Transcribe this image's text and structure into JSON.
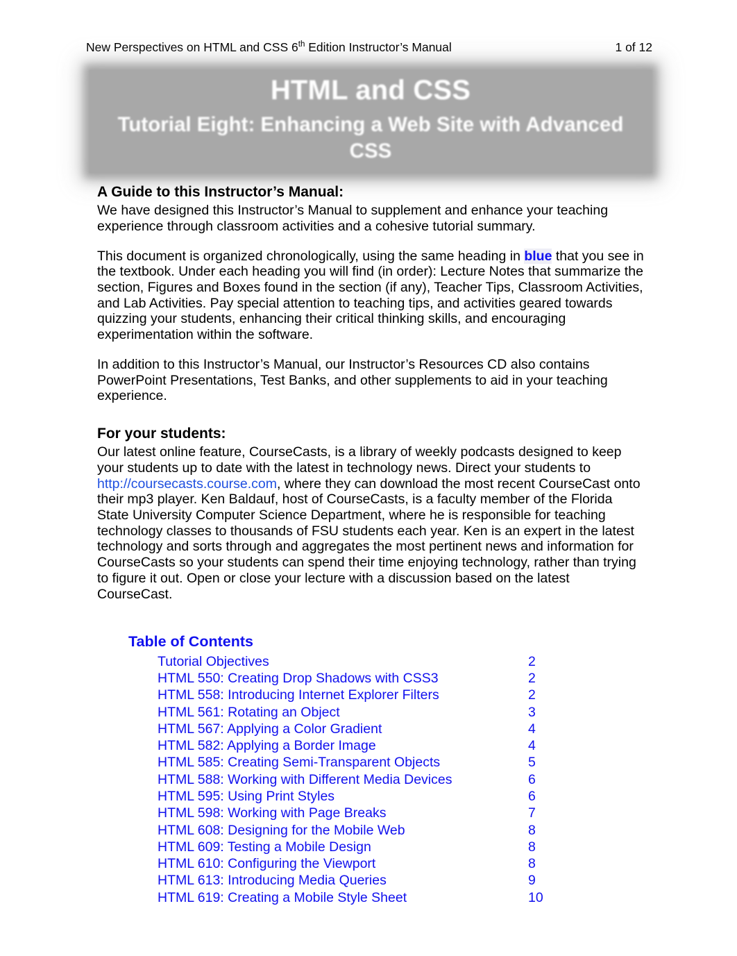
{
  "header": {
    "doc_title_before": "New Perspectives on HTML and CSS 6",
    "doc_title_sup": "th",
    "doc_title_after": " Edition Instructor’s Manual",
    "page_count": "1 of 12"
  },
  "banner": {
    "line1": "HTML and CSS",
    "line2": "Tutorial Eight: Enhancing a Web Site with Advanced CSS",
    "background_color": "#a8a8a8",
    "text_color": "#ffffff"
  },
  "guide": {
    "heading": "A Guide to this Instructor’s Manual:",
    "para1": "We have designed this Instructor’s Manual to supplement and enhance your teaching experience through classroom activities and a cohesive tutorial summary.",
    "para2_part1": "This document is organized chronologically, using the same heading in ",
    "para2_keyword": "blue",
    "para2_part2": " that you see in the textbook. Under each heading you will find (in order): Lecture Notes that summarize the section, Figures and Boxes found in the section (if any), Teacher Tips, Classroom Activities, and Lab Activities. Pay special attention to teaching tips, and activities geared towards quizzing your students, enhancing their critical thinking skills, and encouraging experimentation within the software.",
    "para3": "In addition to this Instructor’s Manual, our Instructor’s Resources CD also contains PowerPoint Presentations, Test Banks, and other supplements to aid in your teaching experience."
  },
  "students": {
    "heading": "For your students:",
    "para_part1": "Our latest online feature, CourseCasts, is a library of weekly podcasts designed to keep your students up to date with the latest in technology news. Direct your students to ",
    "link_text": "http://coursecasts.course.com",
    "para_part2": ", where they can download the most recent CourseCast onto their mp3 player. Ken Baldauf, host of CourseCasts, is a faculty member of the Florida State University Computer Science Department, where he is responsible for teaching technology classes to thousands of FSU students each year. Ken is an expert in the latest technology and sorts through and aggregates the most pertinent news and information for CourseCasts so your students can spend their time enjoying technology, rather than trying to figure it out. Open or close your lecture with a discussion based on the latest CourseCast."
  },
  "toc": {
    "title": "Table of Contents",
    "link_color": "#1111ee",
    "entries": [
      {
        "label": "Tutorial Objectives",
        "page": "2"
      },
      {
        "label": "HTML 550: Creating Drop Shadows with CSS3",
        "page": "2"
      },
      {
        "label": "HTML 558: Introducing Internet Explorer Filters",
        "page": "2"
      },
      {
        "label": "HTML 561: Rotating an Object",
        "page": "3"
      },
      {
        "label": "HTML 567: Applying a Color Gradient",
        "page": "4"
      },
      {
        "label": "HTML 582: Applying a Border Image",
        "page": "4"
      },
      {
        "label": "HTML 585: Creating Semi-Transparent Objects",
        "page": "5"
      },
      {
        "label": "HTML 588: Working with Different Media Devices",
        "page": "6"
      },
      {
        "label": "HTML 595: Using Print Styles",
        "page": "6"
      },
      {
        "label": "HTML 598: Working with Page Breaks",
        "page": "7"
      },
      {
        "label": "HTML 608: Designing for the Mobile Web",
        "page": "8"
      },
      {
        "label": "HTML 609: Testing a Mobile Design",
        "page": "8"
      },
      {
        "label": "HTML 610: Configuring the Viewport",
        "page": "8"
      },
      {
        "label": "HTML 613: Introducing Media Queries",
        "page": "9"
      },
      {
        "label": "HTML 619: Creating a Mobile Style Sheet",
        "page": "10"
      }
    ]
  }
}
